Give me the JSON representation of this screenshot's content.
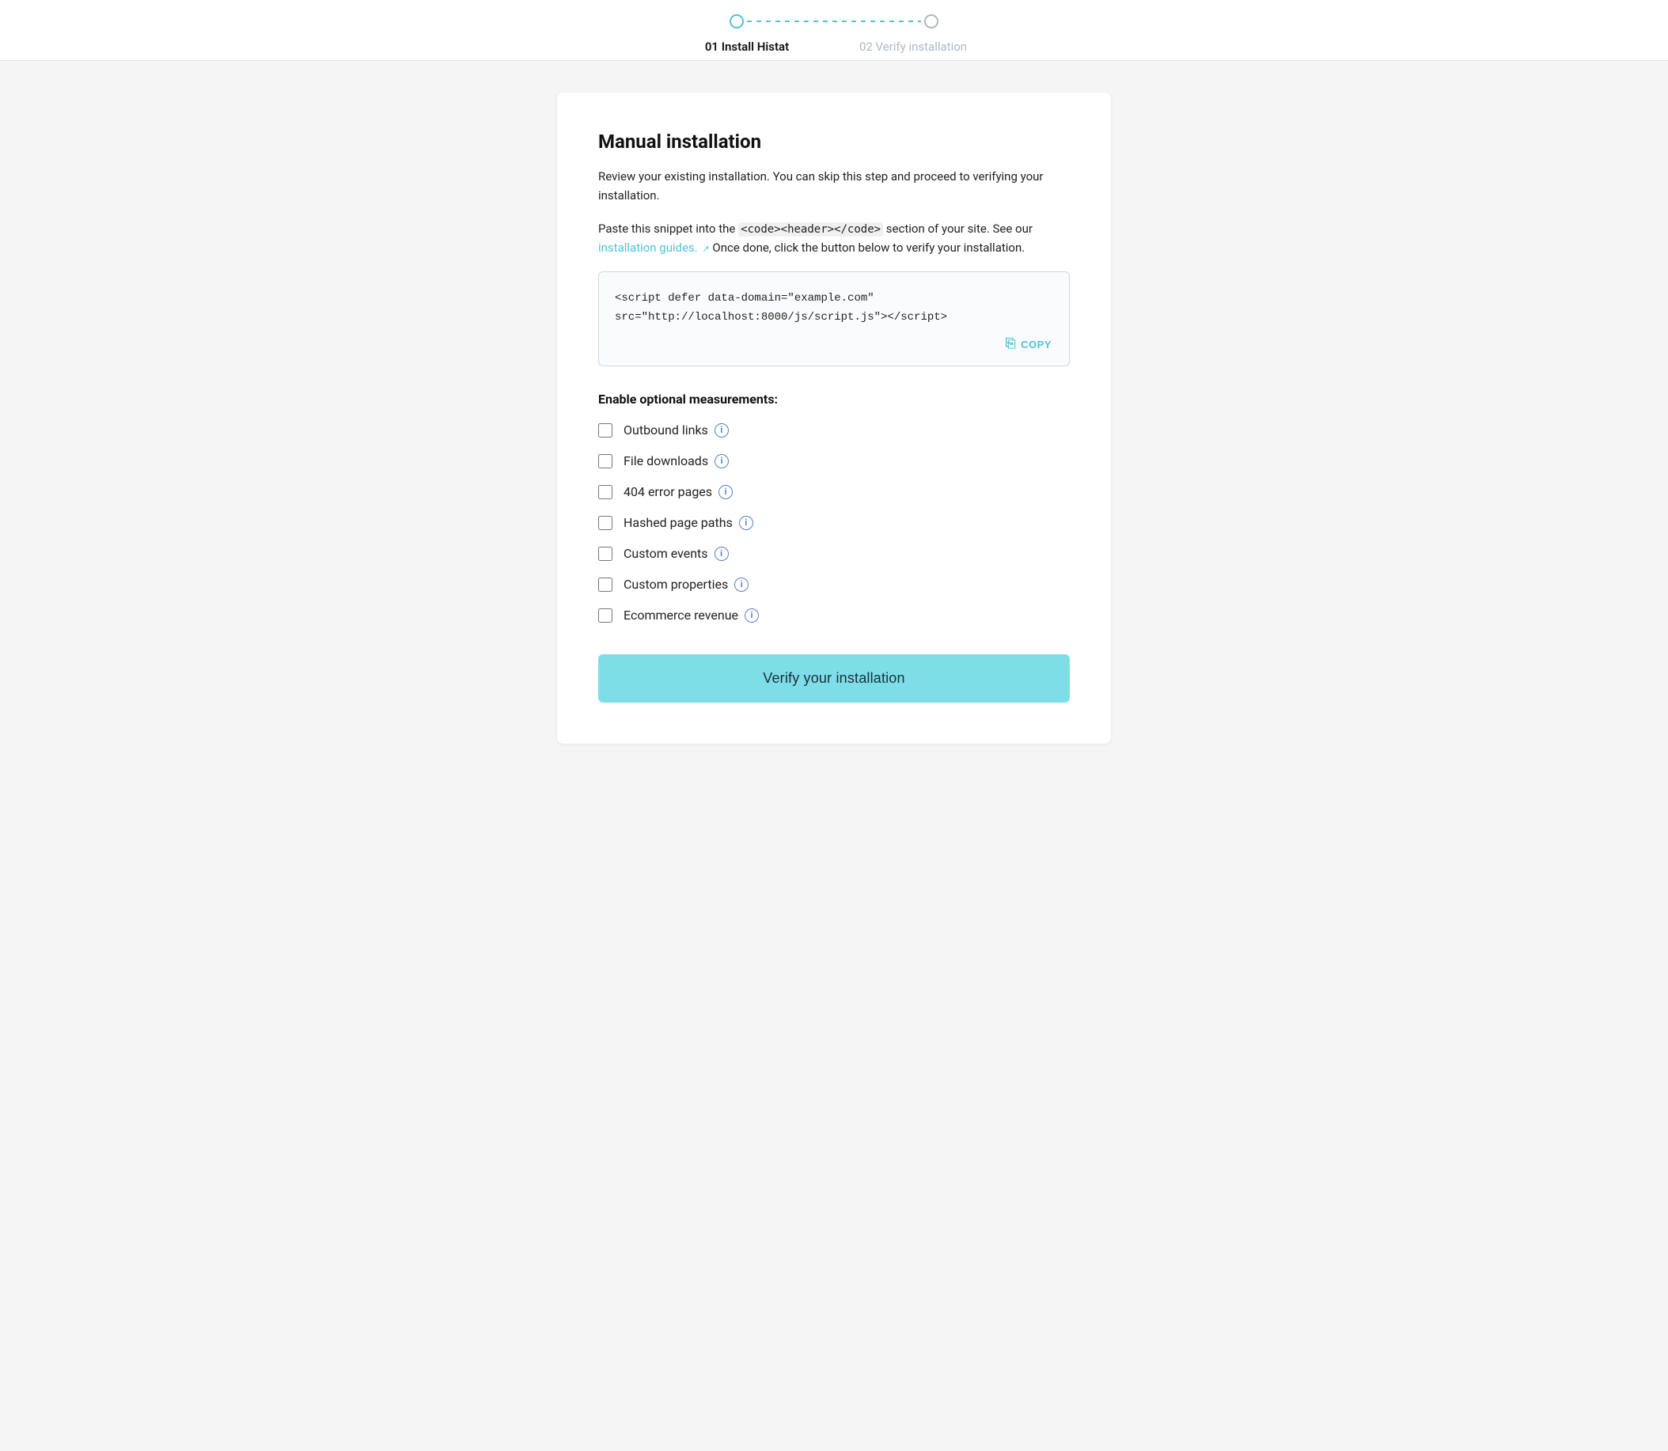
{
  "stepper": {
    "step1_label": "01 Install Histat",
    "step2_label": "02 Verify installation"
  },
  "main": {
    "section_title": "Manual installation",
    "description1": "Review your existing installation. You can skip this step and proceed to verifying your installation.",
    "description2_before": "Paste this snippet into the ",
    "description2_code": "<code><header></code>",
    "description2_middle": " section of your site. See our ",
    "description2_link": "installation guides.",
    "description2_after": " Once done, click the button below to verify your installation.",
    "code_snippet": "<script defer data-domain=\"example.com\"\nsrc=\"http://localhost:8000/js/script.js\"></script>",
    "copy_label": "COPY",
    "measurements_title": "Enable optional measurements:",
    "checkboxes": [
      {
        "id": "outbound",
        "label": "Outbound links"
      },
      {
        "id": "filedownloads",
        "label": "File downloads"
      },
      {
        "id": "error404",
        "label": "404 error pages"
      },
      {
        "id": "hashed",
        "label": "Hashed page paths"
      },
      {
        "id": "customevents",
        "label": "Custom events"
      },
      {
        "id": "customprops",
        "label": "Custom properties"
      },
      {
        "id": "ecommerce",
        "label": "Ecommerce revenue"
      }
    ],
    "verify_button": "Verify your installation"
  },
  "colors": {
    "accent": "#4fc3d9",
    "accent_btn": "#7ddee8",
    "info_icon": "#5a7fbf"
  }
}
